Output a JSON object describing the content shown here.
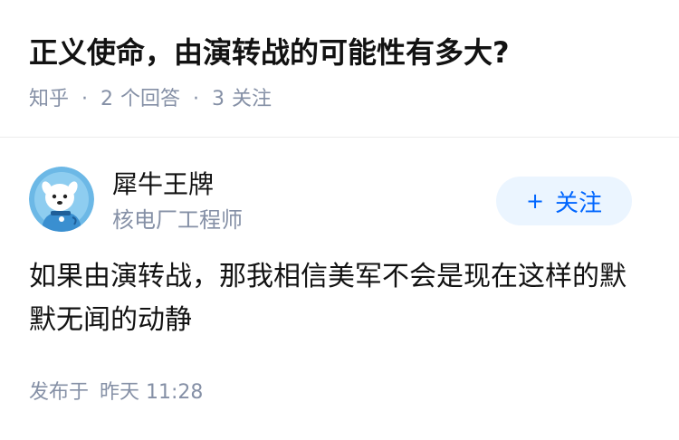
{
  "question": {
    "title": "正义使命，由演转战的可能性有多大?",
    "source": "知乎",
    "separator": "·",
    "answers_count": "2",
    "answers_label": "个回答",
    "followers_count": "3",
    "followers_label": "关注"
  },
  "answer": {
    "author": {
      "name": "犀牛王牌",
      "headline": "核电厂工程师",
      "avatar_icon": "blue-dog-avatar-icon"
    },
    "follow_button": {
      "plus": "+",
      "label": "关注"
    },
    "content": "如果由演转战，那我相信美军不会是现在这样的默默无闻的动静",
    "published_label": "发布于",
    "published_time": "昨天 11:28"
  },
  "colors": {
    "title": "#121212",
    "meta": "#8590a6",
    "accent": "#0066ff",
    "follow_bg": "#ebf5ff",
    "avatar_bg": "#6cb8e6"
  }
}
